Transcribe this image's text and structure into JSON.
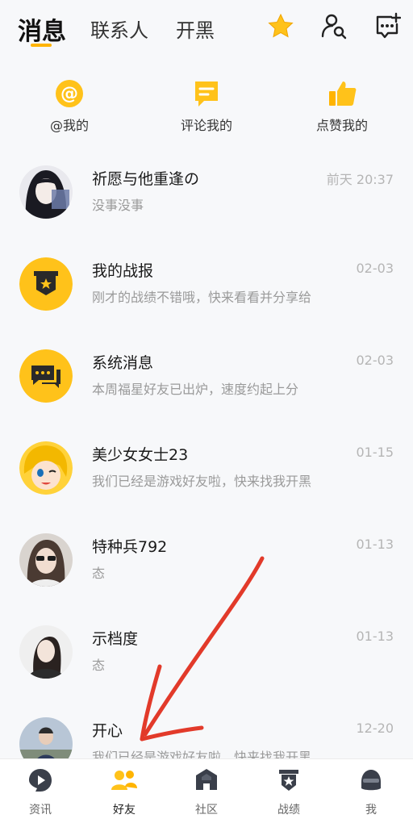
{
  "header": {
    "tabs": [
      {
        "label": "消息",
        "active": true
      },
      {
        "label": "联系人",
        "active": false
      },
      {
        "label": "开黑",
        "active": false
      }
    ],
    "icons": [
      "star-icon",
      "search-user-icon",
      "new-message-icon"
    ],
    "accent": "#ffb400"
  },
  "quick_actions": [
    {
      "label": "@我的",
      "icon": "at-icon"
    },
    {
      "label": "评论我的",
      "icon": "comment-icon"
    },
    {
      "label": "点赞我的",
      "icon": "thumbs-up-icon"
    }
  ],
  "messages": [
    {
      "name": "祈愿与他重逢の",
      "preview": "没事没事",
      "time": "前天 20:37"
    },
    {
      "name": "我的战报",
      "preview": "刚才的战绩不错哦，快来看看并分享给",
      "time": "02-03"
    },
    {
      "name": "系统消息",
      "preview": "本周福星好友已出炉，速度约起上分",
      "time": "02-03"
    },
    {
      "name": "美少女女士23",
      "preview": "我们已经是游戏好友啦，快来找我开黑",
      "time": "01-15"
    },
    {
      "name": "特种兵792",
      "preview": "态",
      "time": "01-13"
    },
    {
      "name": "示档度",
      "preview": "态",
      "time": "01-13"
    },
    {
      "name": "开心",
      "preview": "我们已经是游戏好友啦，快来找我开黑",
      "time": "12-20"
    }
  ],
  "bottom_nav": [
    {
      "label": "资讯",
      "icon": "play-icon",
      "active": false
    },
    {
      "label": "好友",
      "icon": "friends-icon",
      "active": true
    },
    {
      "label": "社区",
      "icon": "community-icon",
      "active": false
    },
    {
      "label": "战绩",
      "icon": "badge-icon",
      "active": false
    },
    {
      "label": "我",
      "icon": "helmet-icon",
      "active": false
    }
  ]
}
